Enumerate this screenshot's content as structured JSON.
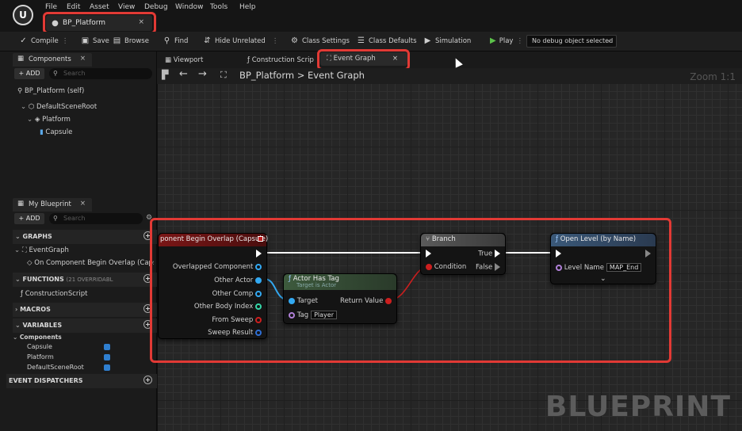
{
  "menu": [
    "File",
    "Edit",
    "Asset",
    "View",
    "Debug",
    "Window",
    "Tools",
    "Help"
  ],
  "doc_tab": {
    "label": "BP_Platform",
    "close": "×"
  },
  "toolbar": {
    "compile": "Compile",
    "save": "Save",
    "browse": "Browse",
    "find": "Find",
    "hide_unrelated": "Hide Unrelated",
    "class_settings": "Class Settings",
    "class_defaults": "Class Defaults",
    "simulation": "Simulation",
    "play": "Play",
    "debug_object": "No debug object selected"
  },
  "components_panel": {
    "tab": "Components",
    "close": "×",
    "add": "+ ADD",
    "search_placeholder": "Search",
    "root": "BP_Platform (self)",
    "items": [
      "DefaultSceneRoot",
      "Platform",
      "Capsule"
    ]
  },
  "my_blueprint": {
    "tab": "My Blueprint",
    "close": "×",
    "add": "+ ADD",
    "search_placeholder": "Search",
    "graphs": "GRAPHS",
    "event_graph": "EventGraph",
    "event_item": "On Component Begin Overlap (Capsule)",
    "functions": "FUNCTIONS",
    "functions_count": "(21 OVERRIDABL",
    "construction": "ConstructionScript",
    "macros": "MACROS",
    "variables": "VARIABLES",
    "components_label": "Components",
    "vars": [
      "Capsule",
      "Platform",
      "DefaultSceneRoot"
    ],
    "dispatchers": "EVENT DISPATCHERS"
  },
  "graph_tabs": {
    "viewport": "Viewport",
    "construction": "Construction Scrip",
    "event_graph": "Event Graph",
    "close": "×"
  },
  "breadcrumb": {
    "bp": "BP_Platform",
    "sep": ">",
    "graph": "Event Graph"
  },
  "zoom": "Zoom 1:1",
  "watermark": "BLUEPRINT",
  "nodes": {
    "overlap": {
      "title": "ponent Begin Overlap (Capsule)",
      "pins": [
        "Overlapped Component",
        "Other Actor",
        "Other Comp",
        "Other Body Index",
        "From Sweep",
        "Sweep Result"
      ]
    },
    "has_tag": {
      "title": "Actor Has Tag",
      "subtitle": "Target is Actor",
      "target": "Target",
      "tag": "Tag",
      "tag_value": "Player",
      "return": "Return Value"
    },
    "branch": {
      "title": "Branch",
      "condition": "Condition",
      "true": "True",
      "false": "False"
    },
    "open_level": {
      "title": "Open Level (by Name)",
      "level_name": "Level Name",
      "level_value": "MAP_End"
    }
  },
  "colors": {
    "highlight": "#e23a35",
    "exec": "#ffffff",
    "object_pin": "#33a9f2",
    "bool_pin": "#cc1f1f",
    "name_pin": "#b080d8",
    "function_header": "#4a6080",
    "event_header": "#6b1414",
    "macro_header": "#505050"
  }
}
